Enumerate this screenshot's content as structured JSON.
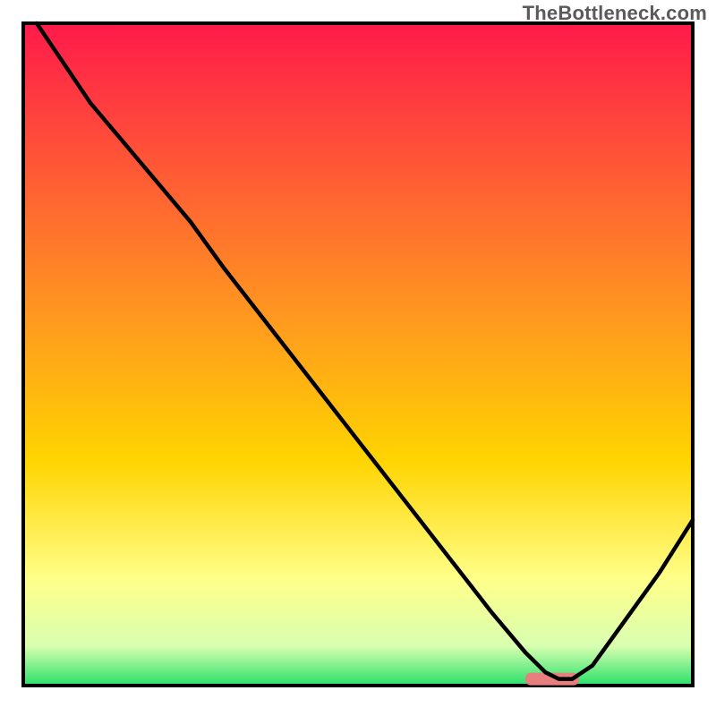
{
  "attribution": "TheBottleneck.com",
  "chart_data": {
    "type": "line",
    "title": "",
    "xlabel": "",
    "ylabel": "",
    "xlim": [
      0,
      100
    ],
    "ylim": [
      0,
      100
    ],
    "x": [
      2,
      10,
      20,
      25,
      30,
      40,
      50,
      60,
      70,
      75,
      78,
      80,
      82,
      85,
      90,
      95,
      100
    ],
    "values": [
      100,
      88,
      76,
      70,
      63,
      50,
      37,
      24,
      11,
      5,
      2,
      1,
      1,
      3,
      10,
      17,
      25
    ],
    "marker_region": {
      "x0": 75,
      "x1": 83,
      "y": 1
    },
    "colors": {
      "gradient_top": "#ff1a4b",
      "gradient_mid": "#ffd400",
      "gradient_low": "#ffff8a",
      "gradient_bottom": "#29e06b",
      "line": "#000000",
      "marker": "#e77f7f",
      "axis": "#000000"
    }
  }
}
